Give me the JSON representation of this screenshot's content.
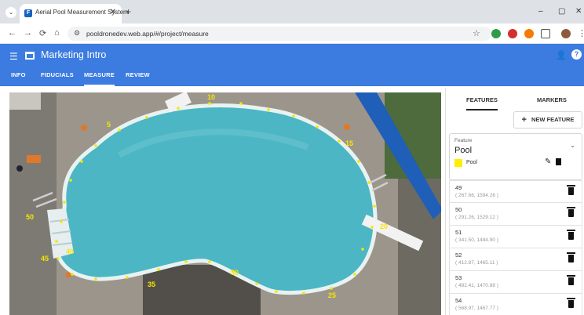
{
  "browser": {
    "tab_title": "Aerial Pool Measurement System",
    "favicon_letter": "F",
    "close_glyph": "✕",
    "new_tab_glyph": "+",
    "url": "pooldronedev.web.app/#/project/measure",
    "back_glyph": "←",
    "forward_glyph": "→",
    "reload_glyph": "⟳",
    "home_glyph": "⌂",
    "star_glyph": "☆",
    "minimize_glyph": "–",
    "maximize_glyph": "▢",
    "window_close_glyph": "✕",
    "extension_colors": [
      "#2e9c4a",
      "#d32f2f",
      "#f57c00",
      "#616161"
    ]
  },
  "app": {
    "title": "Marketing Intro",
    "menu_glyph": "☰",
    "account_glyph": "👤",
    "help_glyph": "?",
    "brand_color": "#3c7be0",
    "tabs": [
      {
        "label": "INFO",
        "active": false
      },
      {
        "label": "FIDUCIALS",
        "active": false
      },
      {
        "label": "MEASURE",
        "active": true
      },
      {
        "label": "REVIEW",
        "active": false
      }
    ]
  },
  "map": {
    "marker_labels": [
      "5",
      "10",
      "15",
      "20",
      "25",
      "30",
      "35",
      "40",
      "45",
      "50"
    ],
    "marker_color": "#f5e600",
    "water_color": "#4cb6c4"
  },
  "panel": {
    "tabs": [
      {
        "label": "FEATURES",
        "active": true
      },
      {
        "label": "MARKERS",
        "active": false
      }
    ],
    "new_feature_label": "NEW FEATURE",
    "new_feature_glyph": "+",
    "feature": {
      "field_label": "Feature",
      "value": "Pool",
      "chevron_glyph": "⌄",
      "swatch_label": "Pool",
      "swatch_color": "#ffee00",
      "edit_glyph": "✎",
      "delete_glyph": "🗑"
    },
    "points": [
      {
        "id": "49",
        "coords": "( 267.66, 1594.26 )"
      },
      {
        "id": "50",
        "coords": "( 291.26, 1529.12 )"
      },
      {
        "id": "51",
        "coords": "( 341.50, 1484.90 )"
      },
      {
        "id": "52",
        "coords": "( 412.87, 1465.11 )"
      },
      {
        "id": "53",
        "coords": "( 482.41, 1470.88 )"
      },
      {
        "id": "54",
        "coords": "( 568.97, 1467.77 )"
      }
    ]
  }
}
